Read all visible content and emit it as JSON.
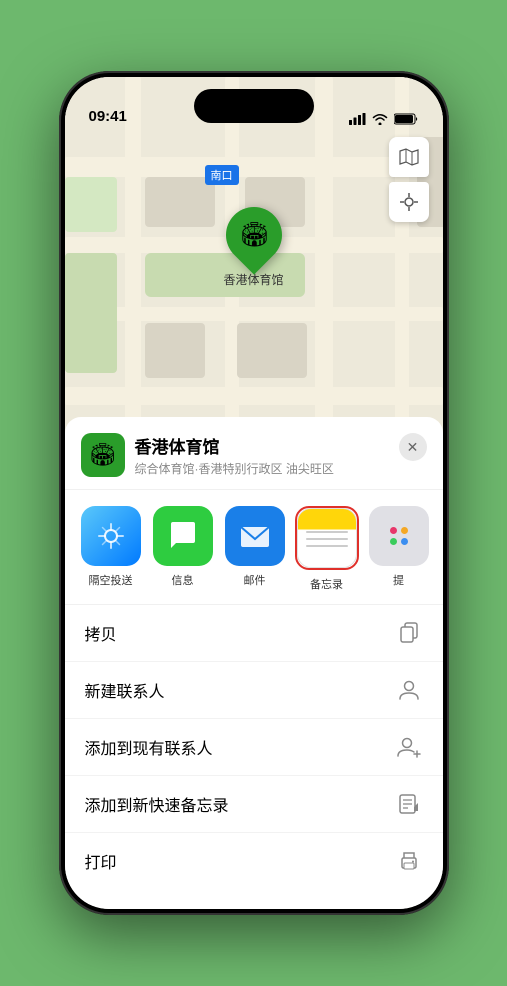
{
  "status": {
    "time": "09:41",
    "location_icon": "▶"
  },
  "map": {
    "label": "南口",
    "label_prefix": "南口"
  },
  "place": {
    "name": "香港体育馆",
    "subtitle": "综合体育馆·香港特别行政区 油尖旺区",
    "icon_emoji": "🏟️"
  },
  "share_actions": [
    {
      "id": "airdrop",
      "label": "隔空投送",
      "type": "airdrop"
    },
    {
      "id": "messages",
      "label": "信息",
      "type": "messages"
    },
    {
      "id": "mail",
      "label": "邮件",
      "type": "mail"
    },
    {
      "id": "notes",
      "label": "备忘录",
      "type": "notes",
      "selected": true
    },
    {
      "id": "more",
      "label": "提",
      "type": "more"
    }
  ],
  "actions": [
    {
      "id": "copy",
      "label": "拷贝",
      "icon": "copy"
    },
    {
      "id": "new-contact",
      "label": "新建联系人",
      "icon": "person"
    },
    {
      "id": "add-to-existing",
      "label": "添加到现有联系人",
      "icon": "person-add"
    },
    {
      "id": "add-to-notes",
      "label": "添加到新快速备忘录",
      "icon": "note"
    },
    {
      "id": "print",
      "label": "打印",
      "icon": "printer"
    }
  ],
  "map_controls": {
    "map_icon": "🗺",
    "location_icon": "◎"
  }
}
